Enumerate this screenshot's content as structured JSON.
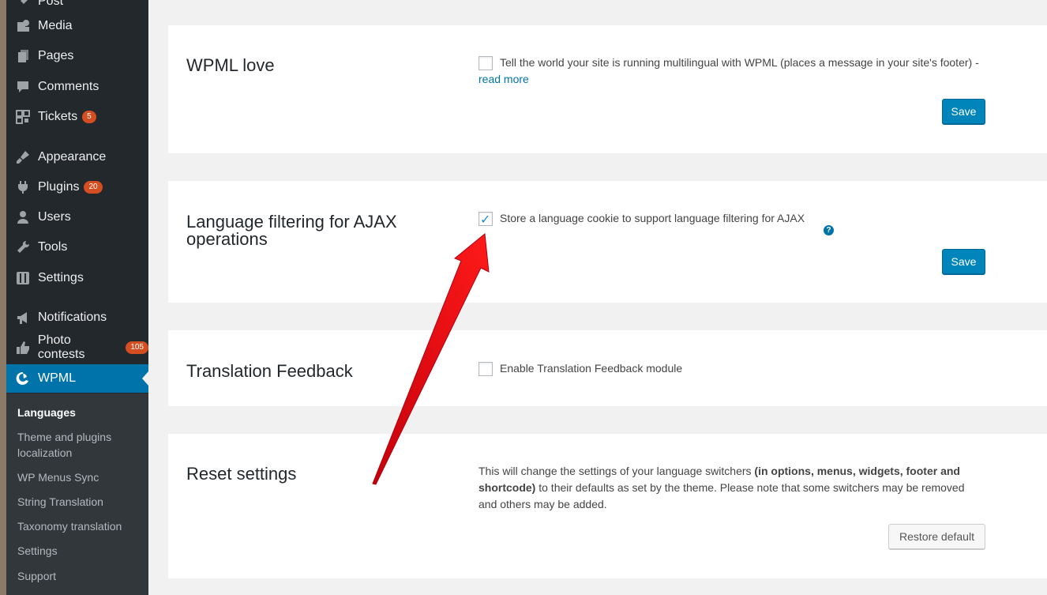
{
  "menu": {
    "items": [
      {
        "label": "Post"
      },
      {
        "label": "Media"
      },
      {
        "label": "Pages"
      },
      {
        "label": "Comments"
      },
      {
        "label": "Tickets",
        "badge": "5"
      },
      {
        "label": "Appearance"
      },
      {
        "label": "Plugins",
        "badge": "20"
      },
      {
        "label": "Users"
      },
      {
        "label": "Tools"
      },
      {
        "label": "Settings"
      },
      {
        "label": "Notifications"
      },
      {
        "label": "Photo contests",
        "badge": "105"
      },
      {
        "label": "WPML"
      }
    ],
    "submenu": [
      "Languages",
      "Theme and plugins localization",
      "WP Menus Sync",
      "String Translation",
      "Taxonomy translation",
      "Settings",
      "Support"
    ]
  },
  "panels": {
    "wpml_love": {
      "title": "WPML love",
      "option_text": "Tell the world your site is running multilingual with WPML (places a message in your site's footer) - ",
      "link": "read more",
      "checked": false,
      "save": "Save"
    },
    "ajax": {
      "title": "Language filtering for AJAX operations",
      "option_text": "Store a language cookie to support language filtering for AJAX",
      "checked": true,
      "help": "?",
      "save": "Save"
    },
    "feedback": {
      "title": "Translation Feedback",
      "option_text": "Enable Translation Feedback module",
      "checked": false
    },
    "reset": {
      "title": "Reset settings",
      "text_before": "This will change the settings of your language switchers ",
      "text_bold": "(in options, menus, widgets, footer and shortcode)",
      "text_after": " to their defaults as set by the theme. Please note that some switchers may be removed and others may be added.",
      "button": "Restore default"
    }
  },
  "colors": {
    "accent": "#0073aa",
    "menu_bg": "#23282d",
    "arrow": "#e3000f"
  }
}
